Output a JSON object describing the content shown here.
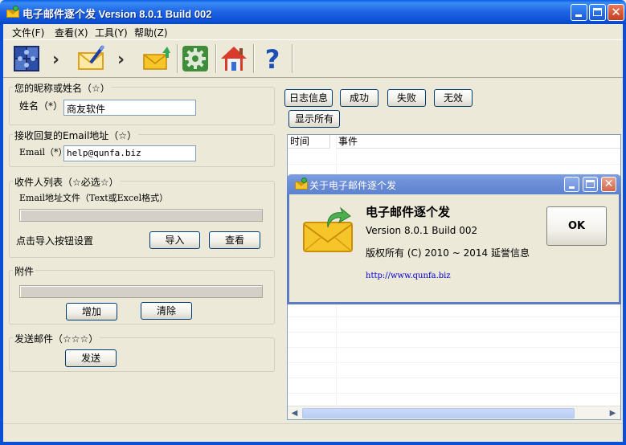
{
  "window": {
    "title": "电子邮件逐个发 Version 8.0.1 Build 002"
  },
  "menu": {
    "items": [
      {
        "label": "文件(F)"
      },
      {
        "label": "查看(X)"
      },
      {
        "label": "工具(Y)"
      },
      {
        "label": "帮助(Z)"
      }
    ]
  },
  "toolbar": {
    "icons": [
      "puzzle-icon",
      "compose-mail-icon",
      "send-mail-icon",
      "gear-icon",
      "home-icon",
      "help-icon"
    ],
    "chevron": "›"
  },
  "sender": {
    "legend": "您的昵称或姓名（☆）",
    "name_label": "姓名（*）",
    "name_value": "商友软件"
  },
  "reply": {
    "legend": "接收回复的Email地址（☆）",
    "email_label": "Email（*）",
    "email_value": "help@qunfa.biz"
  },
  "recipients": {
    "legend": "收件人列表（☆必选☆）",
    "file_label": "Email地址文件（Text或Excel格式）",
    "hint": "点击导入按钮设置",
    "import_label": "导入",
    "view_label": "查看"
  },
  "attachments": {
    "legend": "附件",
    "add_label": "增加",
    "clear_label": "清除"
  },
  "send": {
    "legend": "发送邮件（☆☆☆）",
    "send_label": "发送"
  },
  "log": {
    "filters": [
      "日志信息",
      "成功",
      "失败",
      "无效"
    ],
    "show_all": "显示所有",
    "columns": [
      "时间",
      "事件"
    ]
  },
  "about": {
    "title": "关于电子邮件逐个发",
    "heading": "电子邮件逐个发",
    "version": "Version 8.0.1 Build 002",
    "copyright": "版权所有  (C) 2010 ~ 2014 延誉信息",
    "link": "http://www.qunfa.biz",
    "ok_label": "OK"
  },
  "colors": {
    "titlebar": "#0b4fd4",
    "dialog_titlebar": "#6d8fd8",
    "window_bg": "#ece9d8",
    "link": "#0000cc"
  }
}
